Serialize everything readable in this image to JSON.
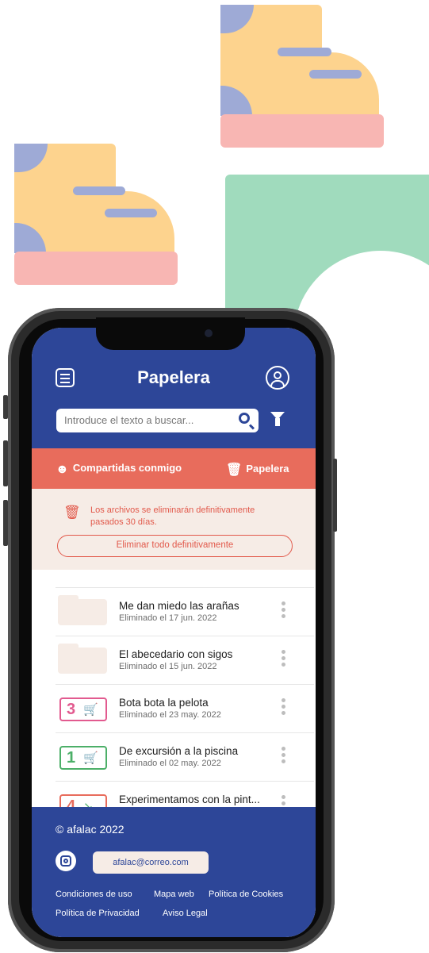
{
  "screen": {
    "title": "Papelera",
    "search": {
      "placeholder": "Introduce el texto a buscar..."
    },
    "tabs": [
      {
        "label": "Compartidas conmigo",
        "icon": "users-icon"
      },
      {
        "label": "Papelera",
        "icon": "trash-icon"
      }
    ],
    "notice": {
      "message": "Los archivos se eliminarán definitivamente pasados 30 días.",
      "button": "Eliminar todo definitivamente"
    },
    "files": [
      {
        "name": "Me dan miedo las arañas",
        "date": "Eliminado el 17 jun. 2022",
        "thumb": "folder"
      },
      {
        "name": "El abecedario con sigos",
        "date": "Eliminado el 15 jun. 2022",
        "thumb": "folder"
      },
      {
        "name": "Bota bota la pelota",
        "date": "Eliminado el 23 may. 2022",
        "thumb": "card",
        "number": "3",
        "color": "#e25a8f"
      },
      {
        "name": "De excursión a la piscina",
        "date": "Eliminado el 02 may. 2022",
        "thumb": "card",
        "number": "1",
        "color": "#4caf68"
      },
      {
        "name": "Experimentamos con la pint...",
        "date": "",
        "thumb": "card",
        "number": "4",
        "color": "#e86c5c"
      }
    ],
    "footer": {
      "copyright": "© afalac 2022",
      "email": "afalac@correo.com",
      "links": [
        "Condiciones de uso",
        "Mapa web",
        "Política de Cookies",
        "Política de Privacidad",
        "Aviso Legal"
      ]
    }
  },
  "colors": {
    "primary": "#2d4698",
    "accent": "#e86c5c",
    "notice_bg": "#f6ece6"
  }
}
